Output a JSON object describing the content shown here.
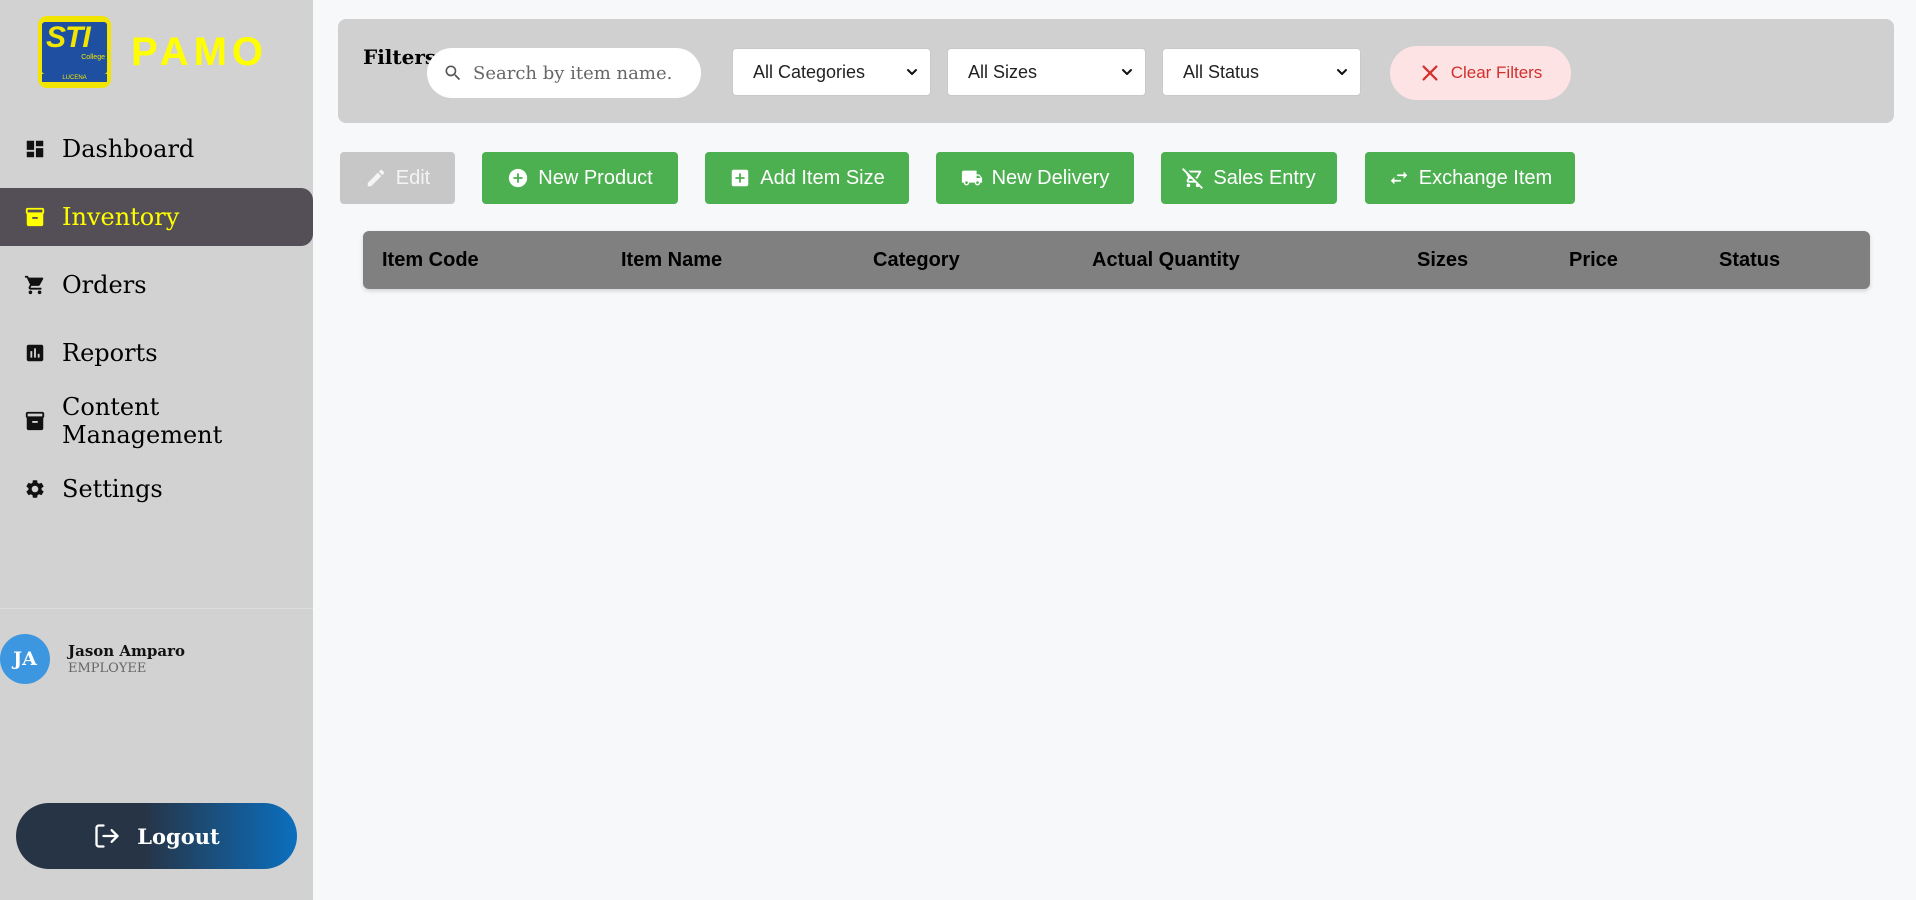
{
  "brand": {
    "name": "PAMO",
    "logo_text": "STI",
    "logo_sub": "College",
    "logo_strip": "LUCENA"
  },
  "sidebar": {
    "items": [
      {
        "label": "Dashboard",
        "icon": "dashboard-icon"
      },
      {
        "label": "Inventory",
        "icon": "inventory-icon",
        "active": true
      },
      {
        "label": "Orders",
        "icon": "cart-icon"
      },
      {
        "label": "Reports",
        "icon": "chart-icon"
      },
      {
        "label": "Content Management",
        "icon": "archive-icon"
      },
      {
        "label": "Settings",
        "icon": "gear-icon"
      }
    ]
  },
  "user": {
    "initials": "JA",
    "name": "Jason Amparo",
    "role": "EMPLOYEE"
  },
  "logout": {
    "label": "Logout"
  },
  "filters": {
    "title": "Filters",
    "search_placeholder": "Search by item name..",
    "category": "All Categories",
    "size": "All Sizes",
    "status": "All Status",
    "clear_label": "Clear Filters"
  },
  "toolbar": {
    "edit": "Edit",
    "new_product": "New Product",
    "add_item_size": "Add Item Size",
    "new_delivery": "New Delivery",
    "sales_entry": "Sales Entry",
    "exchange_item": "Exchange Item"
  },
  "table": {
    "columns": [
      "Item Code",
      "Item Name",
      "Category",
      "Actual Quantity",
      "Sizes",
      "Price",
      "Status"
    ]
  },
  "colors": {
    "accent_green": "#4caf50",
    "active_nav_bg": "#544f56",
    "active_nav_text": "#ffff00",
    "clear_text": "#d32f2f"
  }
}
